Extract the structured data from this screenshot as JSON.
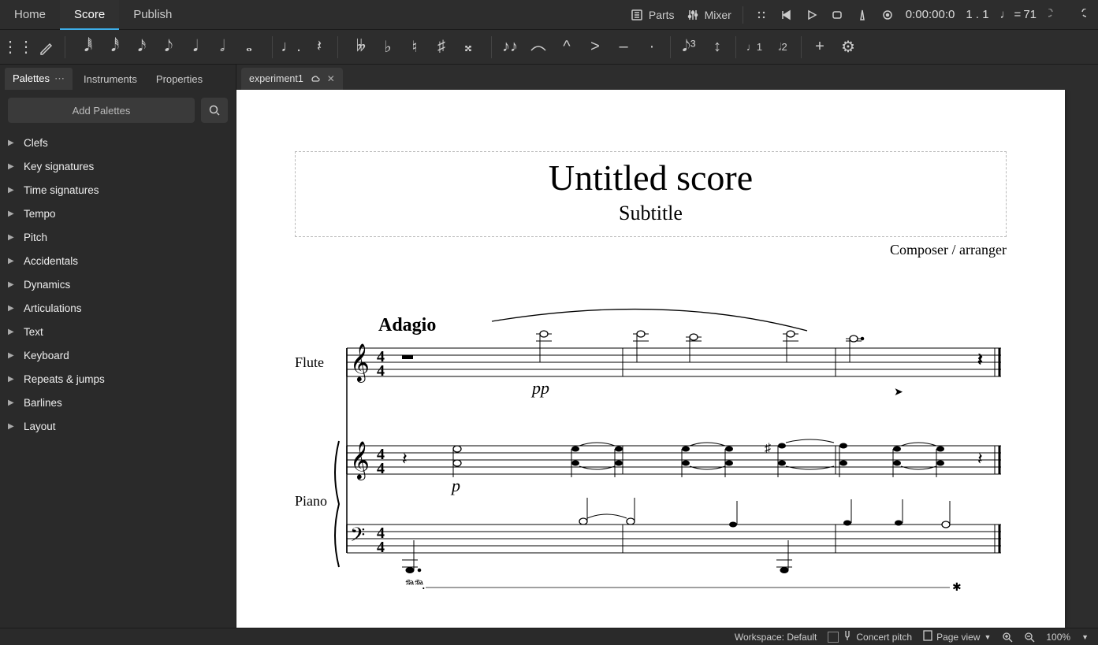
{
  "topbar": {
    "tabs": [
      "Home",
      "Score",
      "Publish"
    ],
    "parts": "Parts",
    "mixer": "Mixer",
    "time": "0:00:00:0",
    "beat": "1 . 1",
    "tempo_prefix": "= ",
    "tempo": "71"
  },
  "toolbar": {
    "notes": [
      "𝅘𝅥𝅱",
      "𝅘𝅥𝅰",
      "𝅘𝅥𝅯",
      "𝅘𝅥𝅮",
      "𝅘𝅥",
      "𝅗𝅥",
      "𝅝"
    ],
    "dot": ".",
    "rest": "𝄽",
    "acc": [
      "𝄫",
      "♭",
      "♮",
      "♯",
      "𝄪"
    ],
    "ties": [
      "𝆣",
      "𝆤"
    ],
    "artic": [
      "^",
      ">",
      "–",
      "·"
    ],
    "tuplet": "𝅘𝅥𝅮³",
    "flip": "↕",
    "voice1": "1",
    "voice2": "2",
    "plus": "+",
    "gear": "⚙"
  },
  "sidebar": {
    "tabs": [
      "Palettes",
      "Instruments",
      "Properties"
    ],
    "add": "Add Palettes",
    "items": [
      "Clefs",
      "Key signatures",
      "Time signatures",
      "Tempo",
      "Pitch",
      "Accidentals",
      "Dynamics",
      "Articulations",
      "Text",
      "Keyboard",
      "Repeats & jumps",
      "Barlines",
      "Layout"
    ]
  },
  "filetab": {
    "name": "experiment1"
  },
  "score": {
    "title": "Untitled score",
    "subtitle": "Subtitle",
    "composer": "Composer / arranger",
    "tempo_mark": "Adagio",
    "inst1": "Flute",
    "inst2": "Piano",
    "dyn1": "pp",
    "dyn2": "p",
    "pedal": "𝆮"
  },
  "status": {
    "workspace": "Workspace: Default",
    "concert": "Concert pitch",
    "view": "Page view",
    "zoom": "100%"
  }
}
